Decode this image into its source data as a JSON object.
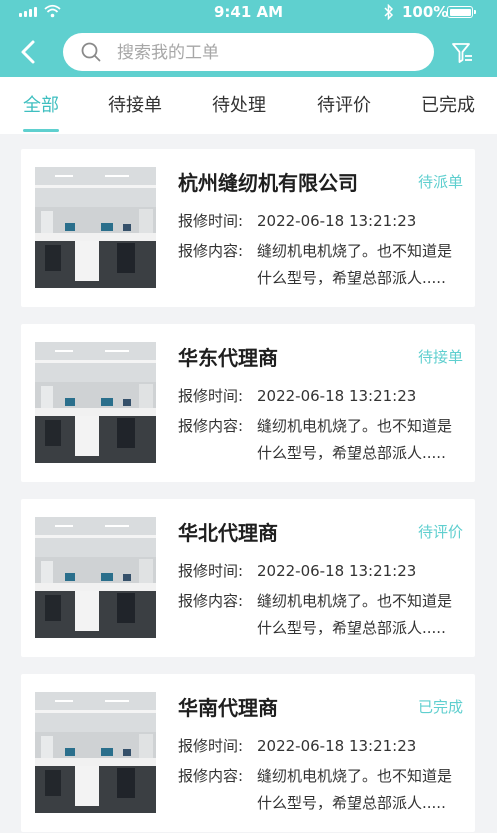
{
  "status_bar": {
    "time": "9:41 AM",
    "battery": "100%"
  },
  "header": {
    "search_placeholder": "搜索我的工单"
  },
  "tabs": [
    {
      "label": "全部",
      "active": true
    },
    {
      "label": "待接单",
      "active": false
    },
    {
      "label": "待处理",
      "active": false
    },
    {
      "label": "待评价",
      "active": false
    },
    {
      "label": "已完成",
      "active": false
    }
  ],
  "orders": [
    {
      "company": "杭州缝纫机有限公司",
      "status": "待派单",
      "time_label": "报修时间:",
      "time_value": "2022-06-18  13:21:23",
      "content_label": "报修内容:",
      "content_line1": "缝纫机电机烧了。也不知道是",
      "content_line2": "什么型号，希望总部派人....."
    },
    {
      "company": "华东代理商",
      "status": "待接单",
      "time_label": "报修时间:",
      "time_value": "2022-06-18  13:21:23",
      "content_label": "报修内容:",
      "content_line1": "缝纫机电机烧了。也不知道是",
      "content_line2": "什么型号，希望总部派人....."
    },
    {
      "company": "华北代理商",
      "status": "待评价",
      "time_label": "报修时间:",
      "time_value": "2022-06-18  13:21:23",
      "content_label": "报修内容:",
      "content_line1": "缝纫机电机烧了。也不知道是",
      "content_line2": "什么型号，希望总部派人....."
    },
    {
      "company": "华南代理商",
      "status": "已完成",
      "time_label": "报修时间:",
      "time_value": "2022-06-18  13:21:23",
      "content_label": "报修内容:",
      "content_line1": "缝纫机电机烧了。也不知道是",
      "content_line2": "什么型号，希望总部派人....."
    }
  ],
  "colors": {
    "accent": "#5fd0cf",
    "background": "#f2f3f5"
  }
}
